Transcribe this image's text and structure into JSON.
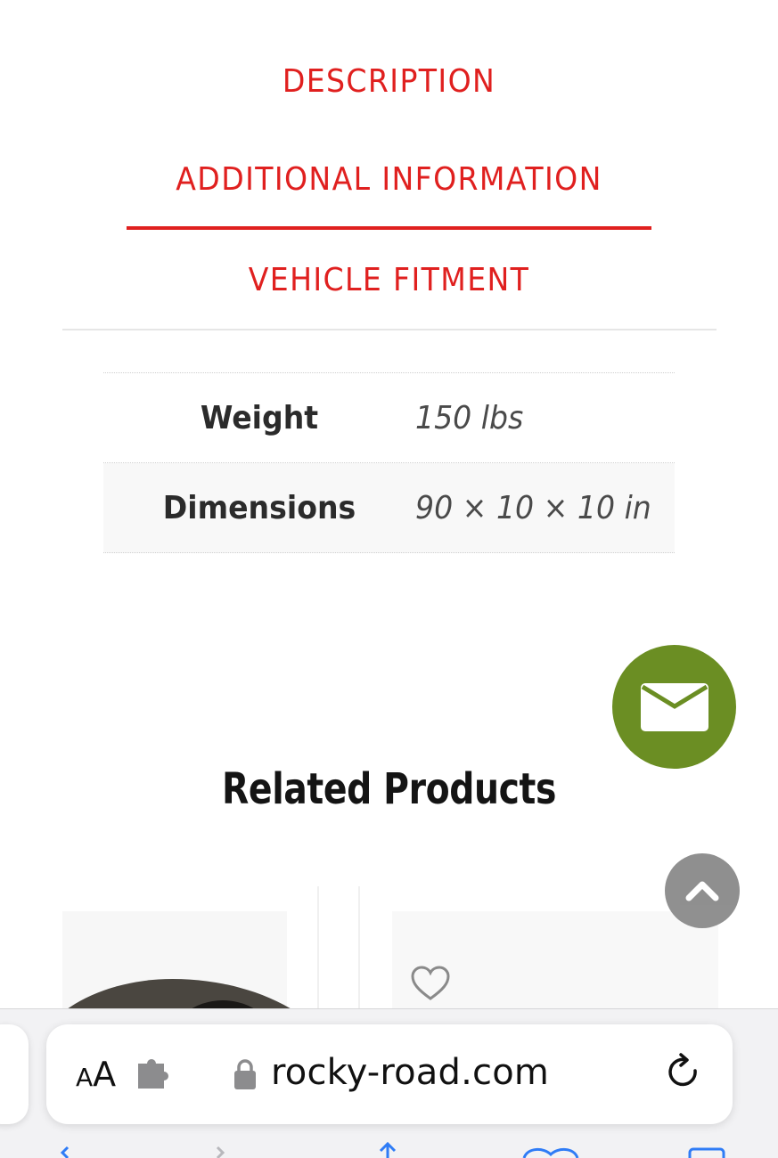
{
  "tabs": [
    {
      "label": "DESCRIPTION"
    },
    {
      "label": "ADDITIONAL INFORMATION"
    },
    {
      "label": "VEHICLE FITMENT"
    }
  ],
  "active_tab": "ADDITIONAL INFORMATION",
  "attributes": [
    {
      "label": "Weight",
      "value": "150 lbs"
    },
    {
      "label": "Dimensions",
      "value": "90 × 10 × 10 in"
    }
  ],
  "related": {
    "title": "Related Products"
  },
  "floating": {
    "mail_icon": "envelope-icon",
    "top_icon": "chevron-up-icon"
  },
  "browser": {
    "aa_small": "A",
    "aa_large": "A",
    "url": "rocky-road.com",
    "icons": [
      "extension-icon",
      "lock-icon",
      "reload-icon"
    ]
  },
  "colors": {
    "accent": "#e0201f",
    "mail_button": "#6b8e23",
    "top_button": "#8a8a8a"
  }
}
